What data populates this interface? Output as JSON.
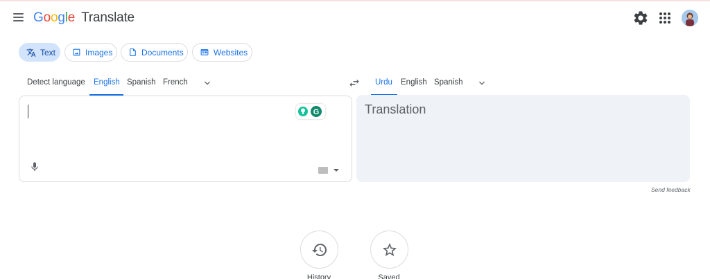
{
  "header": {
    "logo_letters": [
      "G",
      "o",
      "o",
      "g",
      "l",
      "e"
    ],
    "product": "Translate",
    "icons": [
      "menu-icon",
      "settings-icon",
      "apps-icon",
      "avatar"
    ]
  },
  "modes": [
    {
      "label": "Text",
      "icon": "translate-icon",
      "active": true
    },
    {
      "label": "Images",
      "icon": "image-icon",
      "active": false
    },
    {
      "label": "Documents",
      "icon": "document-icon",
      "active": false
    },
    {
      "label": "Websites",
      "icon": "website-icon",
      "active": false
    }
  ],
  "source_langs": {
    "items": [
      "Detect language",
      "English",
      "Spanish",
      "French"
    ],
    "selected": "English"
  },
  "target_langs": {
    "items": [
      "Urdu",
      "English",
      "Spanish"
    ],
    "selected": "Urdu"
  },
  "source": {
    "text": ""
  },
  "target": {
    "placeholder": "Translation"
  },
  "feedback": "Send feedback",
  "bottom": [
    {
      "label": "History",
      "icon": "history-icon"
    },
    {
      "label": "Saved",
      "icon": "star-icon"
    }
  ],
  "colors": {
    "accent": "#1a73e8",
    "chip_active_bg": "#d2e3fc",
    "target_panel_bg": "#eff2f6",
    "grammarly": "#15c39a"
  }
}
